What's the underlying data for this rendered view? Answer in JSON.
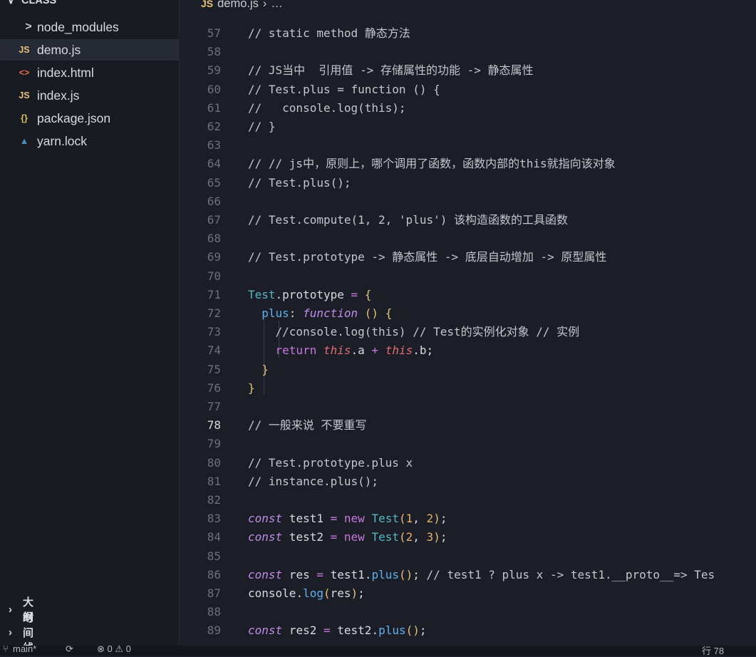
{
  "explorer": {
    "folder": "CLASS",
    "items": [
      {
        "label": "node_modules",
        "icon": ">",
        "icon_name": "chevron-right-icon",
        "icon_color": "#c9ccd4",
        "active": false
      },
      {
        "label": "demo.js",
        "icon": "JS",
        "icon_name": "js-file-icon",
        "icon_color": "#e5c07b",
        "active": true
      },
      {
        "label": "index.html",
        "icon": "<>",
        "icon_name": "html-file-icon",
        "icon_color": "#e06c4b",
        "active": false
      },
      {
        "label": "index.js",
        "icon": "JS",
        "icon_name": "js-file-icon",
        "icon_color": "#e5c07b",
        "active": false
      },
      {
        "label": "package.json",
        "icon": "{}",
        "icon_name": "json-file-icon",
        "icon_color": "#d7c35c",
        "active": false
      },
      {
        "label": "yarn.lock",
        "icon": "▲",
        "icon_name": "yarn-file-icon",
        "icon_color": "#4c8fc2",
        "active": false
      }
    ],
    "outline_label": "大纲",
    "timeline_label": "时间线"
  },
  "breadcrumb": {
    "file": "demo.js",
    "rest": "…"
  },
  "editor": {
    "current_line": 78,
    "lines": [
      {
        "n": "57",
        "code": "// static method 静态方法"
      },
      {
        "n": "58",
        "code": ""
      },
      {
        "n": "59",
        "code": "// JS当中  引用值 -> 存储属性的功能 -> 静态属性"
      },
      {
        "n": "60",
        "code": "// Test.plus = function () {"
      },
      {
        "n": "61",
        "code": "//   console.log(this);"
      },
      {
        "n": "62",
        "code": "// }"
      },
      {
        "n": "63",
        "code": ""
      },
      {
        "n": "64",
        "code": "// // js中，原则上，哪个调用了函数，函数内部的this就指向该对象"
      },
      {
        "n": "65",
        "code": "// Test.plus();"
      },
      {
        "n": "66",
        "code": ""
      },
      {
        "n": "67",
        "code": "// Test.compute(1, 2, 'plus') 该构造函数的工具函数"
      },
      {
        "n": "68",
        "code": ""
      },
      {
        "n": "69",
        "code": "// Test.prototype -> 静态属性 -> 底层自动增加 -> 原型属性"
      },
      {
        "n": "70",
        "code": ""
      },
      {
        "n": "71",
        "code": "Test.prototype = {"
      },
      {
        "n": "72",
        "code": "  plus: function () {"
      },
      {
        "n": "73",
        "code": "    //console.log(this) // Test的实例化对象 // 实例"
      },
      {
        "n": "74",
        "code": "    return this.a + this.b;"
      },
      {
        "n": "75",
        "code": "  }"
      },
      {
        "n": "76",
        "code": "}"
      },
      {
        "n": "77",
        "code": ""
      },
      {
        "n": "78",
        "code": "// 一般来说 不要重写"
      },
      {
        "n": "79",
        "code": ""
      },
      {
        "n": "80",
        "code": "// Test.prototype.plus x"
      },
      {
        "n": "81",
        "code": "// instance.plus();"
      },
      {
        "n": "82",
        "code": ""
      },
      {
        "n": "83",
        "code": "const test1 = new Test(1, 2);"
      },
      {
        "n": "84",
        "code": "const test2 = new Test(2, 3);"
      },
      {
        "n": "85",
        "code": ""
      },
      {
        "n": "86",
        "code": "const res = test1.plus(); // test1 ? plus x -> test1.__proto__=> Tes"
      },
      {
        "n": "87",
        "code": "console.log(res);"
      },
      {
        "n": "88",
        "code": ""
      },
      {
        "n": "89",
        "code": "const res2 = test2.plus();"
      }
    ]
  },
  "status": {
    "branch": "main*",
    "problems": "⊗ 0 ⚠ 0",
    "cursor": "行 78"
  }
}
